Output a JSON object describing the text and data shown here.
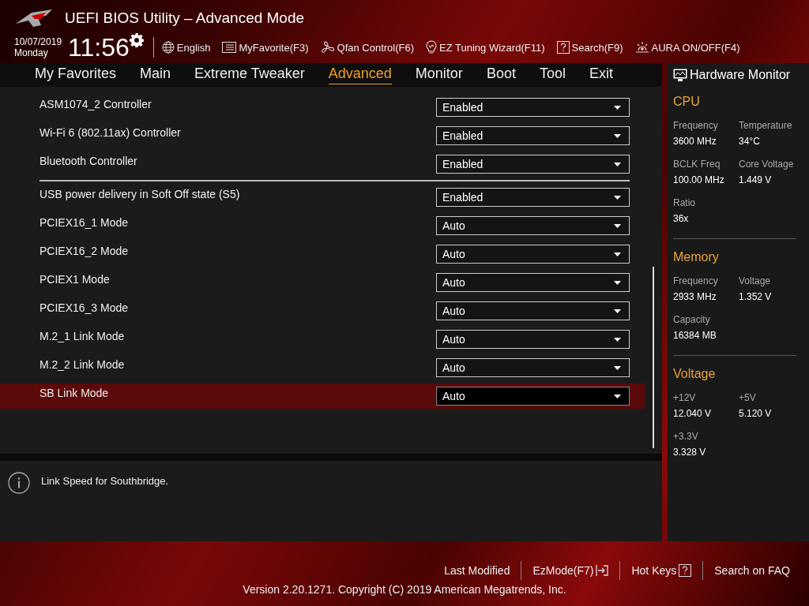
{
  "window": {
    "title": "UEFI BIOS Utility – Advanced Mode"
  },
  "header": {
    "date": "10/07/2019",
    "day": "Monday",
    "time": "11:56",
    "tools": [
      {
        "label": "English"
      },
      {
        "label": "MyFavorite(F3)"
      },
      {
        "label": "Qfan Control(F6)"
      },
      {
        "label": "EZ Tuning Wizard(F11)"
      },
      {
        "label": "Search(F9)"
      },
      {
        "label": "AURA ON/OFF(F4)"
      }
    ]
  },
  "tabs": [
    {
      "label": "My Favorites",
      "selected": false
    },
    {
      "label": "Main",
      "selected": false
    },
    {
      "label": "Extreme Tweaker",
      "selected": false
    },
    {
      "label": "Advanced",
      "selected": true
    },
    {
      "label": "Monitor",
      "selected": false
    },
    {
      "label": "Boot",
      "selected": false
    },
    {
      "label": "Tool",
      "selected": false
    },
    {
      "label": "Exit",
      "selected": false
    }
  ],
  "setting_groups": [
    {
      "items": [
        {
          "label": "ASM1074_2 Controller",
          "value": "Enabled",
          "selected": false
        },
        {
          "label": "Wi-Fi 6 (802.11ax) Controller",
          "value": "Enabled",
          "selected": false
        },
        {
          "label": "Bluetooth Controller",
          "value": "Enabled",
          "selected": false
        }
      ]
    },
    {
      "items": [
        {
          "label": "USB power delivery in Soft Off state (S5)",
          "value": "Enabled",
          "selected": false
        },
        {
          "label": "PCIEX16_1 Mode",
          "value": "Auto",
          "selected": false
        },
        {
          "label": "PCIEX16_2 Mode",
          "value": "Auto",
          "selected": false
        },
        {
          "label": "PCIEX1 Mode",
          "value": "Auto",
          "selected": false
        },
        {
          "label": "PCIEX16_3 Mode",
          "value": "Auto",
          "selected": false
        },
        {
          "label": "M.2_1 Link Mode",
          "value": "Auto",
          "selected": false
        },
        {
          "label": "M.2_2 Link Mode",
          "value": "Auto",
          "selected": false
        },
        {
          "label": "SB Link Mode",
          "value": "Auto",
          "selected": true
        }
      ]
    }
  ],
  "help": {
    "text": "Link Speed for Southbridge."
  },
  "hardware_monitor": {
    "title": "Hardware Monitor",
    "sections": [
      {
        "title": "CPU",
        "readings": [
          {
            "label": "Frequency",
            "value": "3600 MHz"
          },
          {
            "label": "Temperature",
            "value": "34°C"
          },
          {
            "label": "BCLK Freq",
            "value": "100.00 MHz"
          },
          {
            "label": "Core Voltage",
            "value": "1.449 V"
          },
          {
            "label": "Ratio",
            "value": "36x"
          }
        ]
      },
      {
        "title": "Memory",
        "readings": [
          {
            "label": "Frequency",
            "value": "2933 MHz"
          },
          {
            "label": "Voltage",
            "value": "1.352 V"
          },
          {
            "label": "Capacity",
            "value": "16384 MB"
          }
        ]
      },
      {
        "title": "Voltage",
        "readings": [
          {
            "label": "+12V",
            "value": "12.040 V"
          },
          {
            "label": "+5V",
            "value": "5.120 V"
          },
          {
            "label": "+3.3V",
            "value": "3.328 V"
          }
        ]
      }
    ]
  },
  "footer": {
    "links": [
      {
        "label": "Last Modified"
      },
      {
        "label": "EzMode(F7)"
      },
      {
        "label": "Hot Keys"
      },
      {
        "label": "Search on FAQ"
      }
    ],
    "version": "Version 2.20.1271. Copyright (C) 2019 American Megatrends, Inc."
  }
}
